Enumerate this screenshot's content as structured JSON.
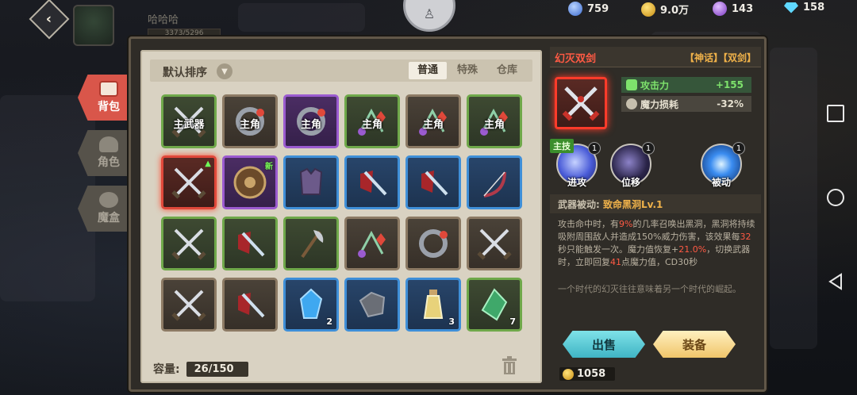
{
  "player": {
    "name": "哈哈哈",
    "exp": "3373/5296"
  },
  "currencies": [
    {
      "icon": "gem-blue-icon",
      "value": "759",
      "color": "#6aa3ff"
    },
    {
      "icon": "gold-coin-icon",
      "value": "9.0万",
      "color": "#f0c23a"
    },
    {
      "icon": "purple-gem-icon",
      "value": "143",
      "color": "#a468e6"
    },
    {
      "icon": "diamond-icon",
      "value": "158",
      "color": "#5fd8ff"
    }
  ],
  "side_tabs": {
    "bag": "背包",
    "role": "角色",
    "gem": "魔盒"
  },
  "inventory": {
    "sort_label": "默认排序",
    "tabs": [
      "普通",
      "特殊",
      "仓库"
    ],
    "capacity_label": "容量:",
    "capacity_value": "26/150",
    "slots": [
      {
        "quality": "green",
        "icon": "crossed-swords",
        "tag": "主武器"
      },
      {
        "quality": "brown",
        "icon": "ring",
        "tag": "主角"
      },
      {
        "quality": "purple",
        "icon": "ring",
        "tag": "主角"
      },
      {
        "quality": "green",
        "icon": "gem-earring",
        "tag": "主角"
      },
      {
        "quality": "brown",
        "icon": "gem-earring",
        "tag": "主角"
      },
      {
        "quality": "green",
        "icon": "gem-earring",
        "tag": "主角"
      },
      {
        "quality": "red",
        "icon": "crossed-swords",
        "upgrade": true
      },
      {
        "quality": "purple",
        "icon": "shield",
        "new": "新"
      },
      {
        "quality": "blue",
        "icon": "armor"
      },
      {
        "quality": "blue",
        "icon": "sword-shield"
      },
      {
        "quality": "blue",
        "icon": "sword-shield"
      },
      {
        "quality": "blue",
        "icon": "bow"
      },
      {
        "quality": "green",
        "icon": "crossed-swords"
      },
      {
        "quality": "green",
        "icon": "sword-shield"
      },
      {
        "quality": "green",
        "icon": "axe"
      },
      {
        "quality": "brown",
        "icon": "gem-earring"
      },
      {
        "quality": "brown",
        "icon": "ring"
      },
      {
        "quality": "brown",
        "icon": "crossed-swords"
      },
      {
        "quality": "brown",
        "icon": "crossed-swords"
      },
      {
        "quality": "brown",
        "icon": "sword-shield"
      },
      {
        "quality": "blue",
        "icon": "blue-crystal",
        "count": "2"
      },
      {
        "quality": "blue",
        "icon": "stone"
      },
      {
        "quality": "blue",
        "icon": "potion",
        "count": "3"
      },
      {
        "quality": "green",
        "icon": "green-crystal",
        "count": "7"
      }
    ]
  },
  "detail": {
    "name": "幻灭双剑",
    "tags": "【神话】【双剑】",
    "stat_atk_label": "攻击力",
    "stat_atk_value": "+155",
    "stat_mana_label": "魔力损耗",
    "stat_mana_value": "-32%",
    "main_tag": "主技",
    "skills": [
      {
        "name": "进攻",
        "level": "1",
        "color": "#4a5cd8"
      },
      {
        "name": "位移",
        "level": "1",
        "color": "#2a2448"
      },
      {
        "name": "被动",
        "level": "1",
        "color": "#1a5ac8"
      }
    ],
    "passive_label": "武器被动:",
    "passive_name": "致命黑洞Lv.1",
    "desc_1": "攻击命中时，有",
    "desc_p1": "9%",
    "desc_2": "的几率召唤出黑洞，黑洞将持续吸附周围敌人并造成150%威力伤害，该效果每",
    "desc_p2": "32",
    "desc_3": "秒只能触发一次。魔力值恢复+",
    "desc_p3": "21.0%",
    "desc_4": "，切换武器时，立即回复",
    "desc_p4": "41",
    "desc_5": "点魔力值，CD30秒",
    "flavor": "一个时代的幻灭往往意味着另一个时代的崛起。",
    "sell_label": "出售",
    "equip_label": "装备",
    "gold": "1058"
  }
}
